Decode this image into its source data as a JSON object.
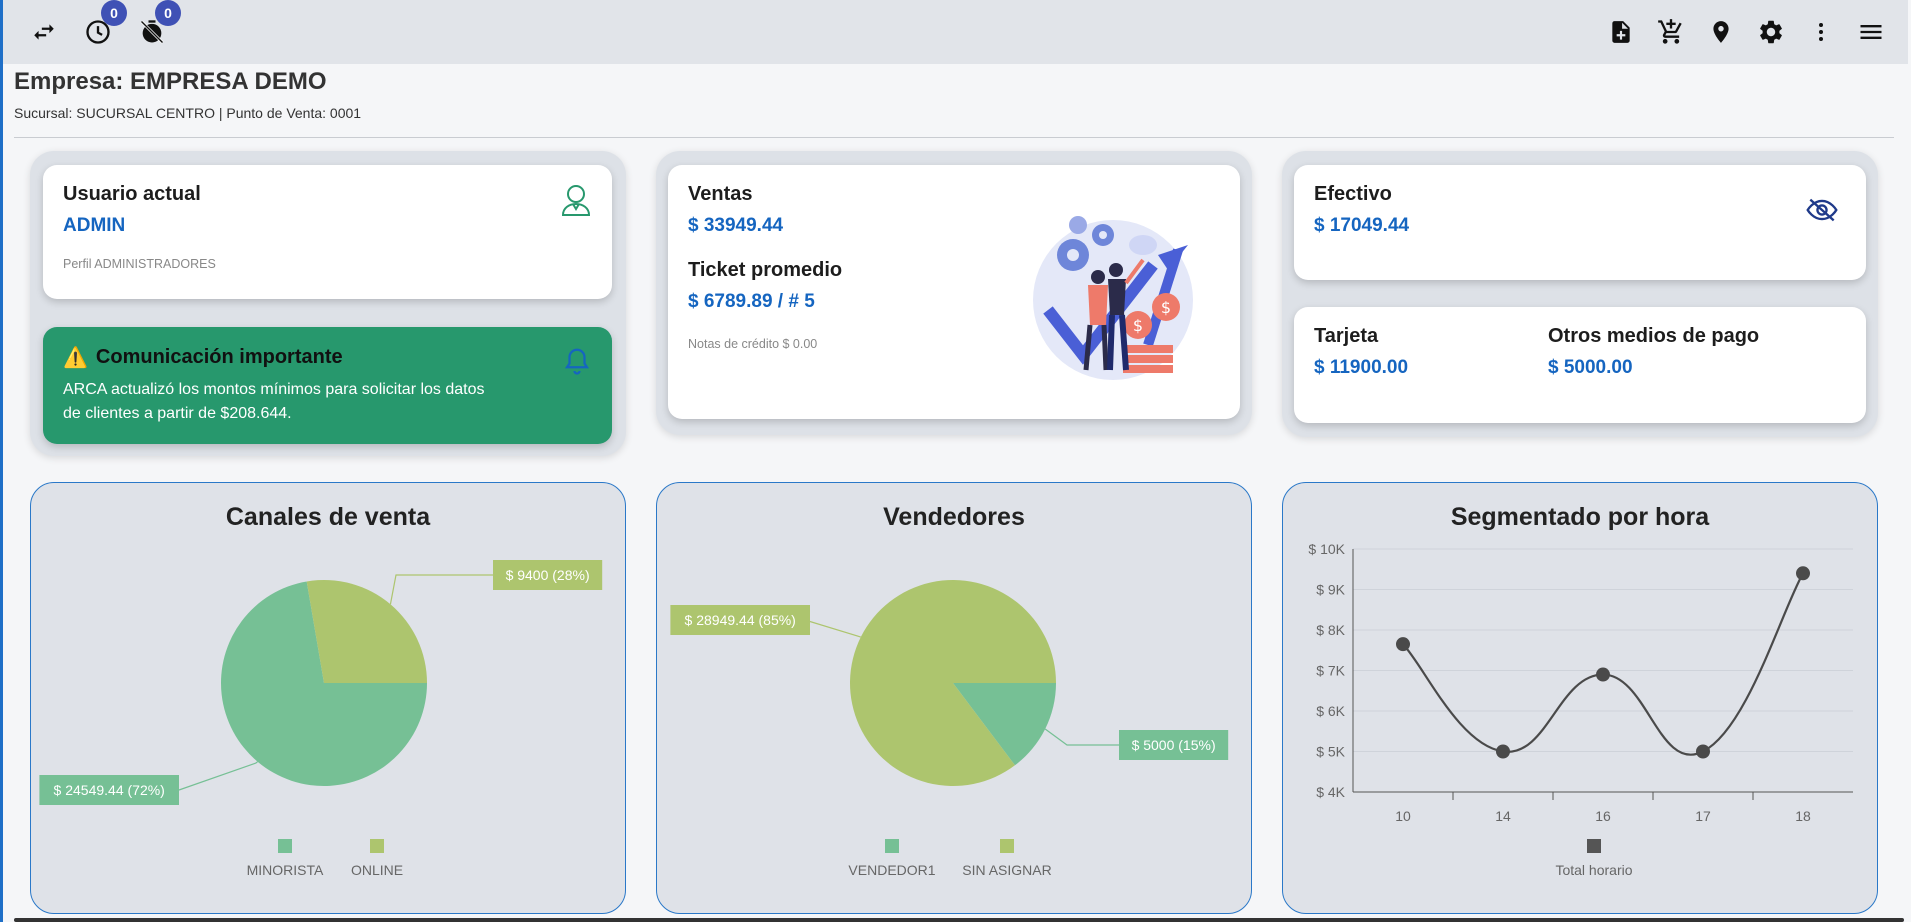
{
  "topbar": {
    "left_icons": [
      {
        "icon": "swap-arrows-icon"
      },
      {
        "icon": "clock-icon",
        "badge": "0"
      },
      {
        "icon": "timer-off-icon",
        "badge": "0"
      }
    ],
    "right_icons": [
      "note-add-icon",
      "add-cart-icon",
      "location-pin-icon",
      "gear-icon",
      "more-vert-icon",
      "menu-icon"
    ]
  },
  "header": {
    "company": "Empresa: EMPRESA DEMO",
    "branch_info": "Sucursal: SUCURSAL CENTRO | Punto de Venta: 0001"
  },
  "user_card": {
    "label": "Usuario actual",
    "value": "ADMIN",
    "profile": "Perfil ADMINISTRADORES"
  },
  "alert": {
    "title": "Comunicación importante",
    "message": "ARCA actualizó los montos mínimos para solicitar los datos de clientes a partir de $208.644."
  },
  "sales_card": {
    "ventas_label": "Ventas",
    "ventas_value": "$ 33949.44",
    "ticket_label": "Ticket promedio",
    "ticket_value": "$ 6789.89 / # 5",
    "credit_notes": "Notas de crédito $ 0.00"
  },
  "cash_card": {
    "label": "Efectivo",
    "value": "$ 17049.44"
  },
  "payment_card": {
    "tarjeta_label": "Tarjeta",
    "tarjeta_value": "$ 11900.00",
    "otros_label": "Otros medios de pago",
    "otros_value": "$ 5000.00"
  },
  "colors": {
    "accent_blue": "#1565c0",
    "alert_green": "#27986d",
    "pie_green": "#76c095",
    "pie_olive": "#adc56e",
    "line_dark": "#4a4a4a"
  },
  "chart_data": [
    {
      "type": "pie",
      "title": "Canales de venta",
      "categories": [
        "MINORISTA",
        "ONLINE"
      ],
      "values": [
        24549.44,
        9400
      ],
      "labels": [
        "$ 24549.44 (72%)",
        "$ 9400 (28%)"
      ],
      "colors": [
        "#76c095",
        "#adc56e"
      ]
    },
    {
      "type": "pie",
      "title": "Vendedores",
      "categories": [
        "VENDEDOR1",
        "SIN ASIGNAR"
      ],
      "values": [
        5000,
        28949.44
      ],
      "labels": [
        "$ 5000 (15%)",
        "$ 28949.44 (85%)"
      ],
      "colors": [
        "#76c095",
        "#adc56e"
      ]
    },
    {
      "type": "line",
      "title": "Segmentado por hora",
      "x": [
        "10",
        "14",
        "16",
        "17",
        "18"
      ],
      "series": [
        {
          "name": "Total horario",
          "values": [
            7650,
            5000,
            6900,
            5000,
            9400
          ]
        }
      ],
      "ylim": [
        4000,
        10000
      ],
      "yticks": [
        "$ 4K",
        "$ 5K",
        "$ 6K",
        "$ 7K",
        "$ 8K",
        "$ 9K",
        "$ 10K"
      ],
      "grid": true,
      "legend": "bottom"
    }
  ]
}
